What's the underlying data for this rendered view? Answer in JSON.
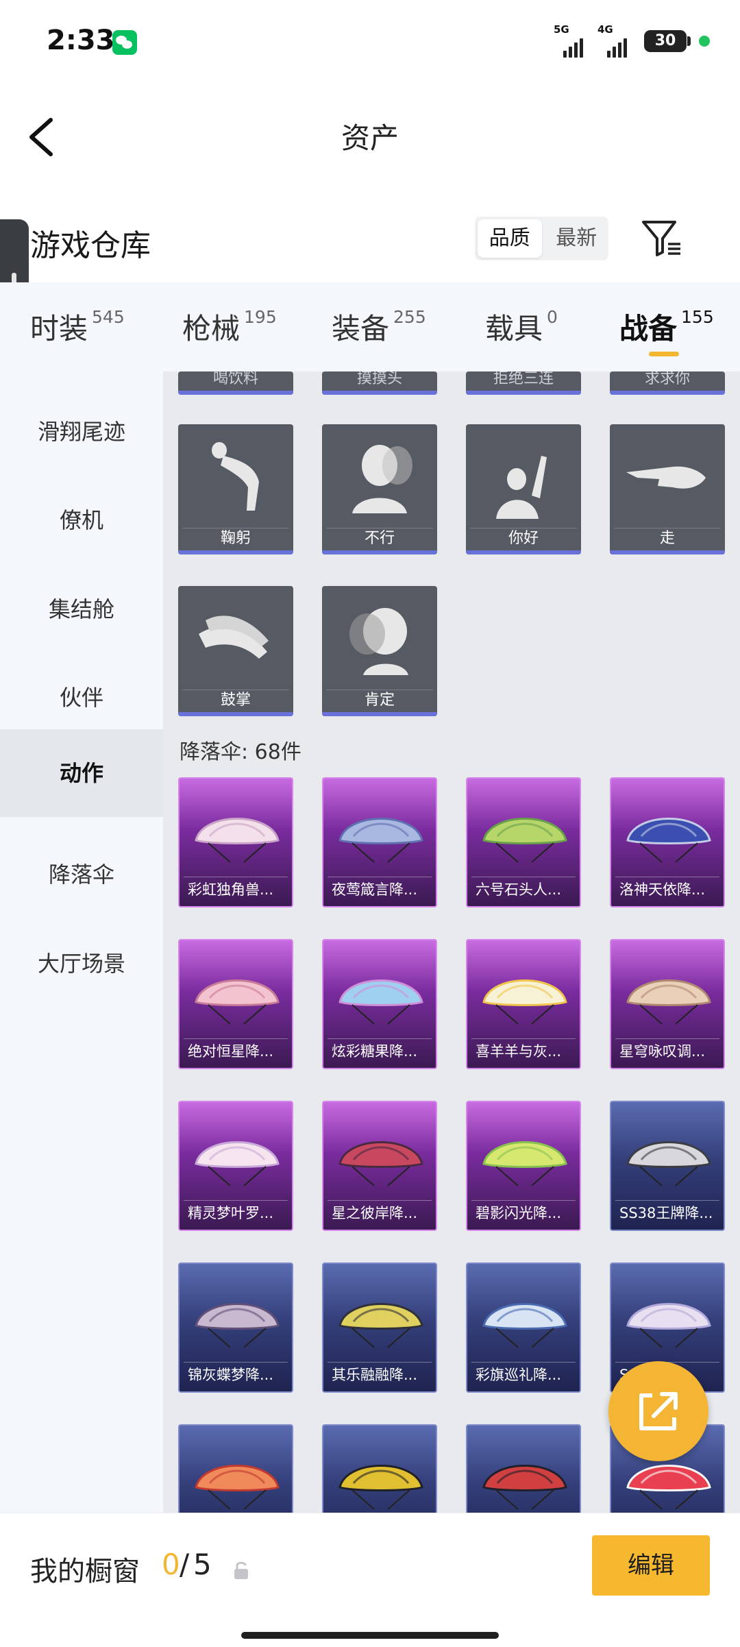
{
  "status_bar": {
    "time": "2:33",
    "sig1_label": "5G",
    "sig2_label": "4G",
    "battery": "30"
  },
  "header": {
    "title": "资产"
  },
  "section": {
    "title": "游戏仓库",
    "sort_options": [
      "品质",
      "最新"
    ]
  },
  "tabs": [
    {
      "label": "时装",
      "count": "545"
    },
    {
      "label": "枪械",
      "count": "195"
    },
    {
      "label": "装备",
      "count": "255"
    },
    {
      "label": "载具",
      "count": "0"
    },
    {
      "label": "战备",
      "count": "155",
      "active": true
    }
  ],
  "sidenav": [
    "滑翔尾迹",
    "僚机",
    "集结舱",
    "伙伴",
    "动作",
    "降落伞",
    "大厅场景"
  ],
  "sidenav_active": "动作",
  "actions_partial": [
    "喝饮料",
    "摸摸头",
    "拒绝三连",
    "求求你"
  ],
  "actions": [
    "鞠躬",
    "不行",
    "你好",
    "走",
    "鼓掌",
    "肯定"
  ],
  "parachute_heading": "降落伞: 68件",
  "parachutes": [
    "彩虹独角兽...",
    "夜莺箴言降...",
    "六号石头人...",
    "洛神天依降...",
    "绝对恒星降...",
    "炫彩糖果降...",
    "喜羊羊与灰...",
    "星穹咏叹调...",
    "精灵梦叶罗...",
    "星之彼岸降...",
    "碧影闪光降...",
    "SS38王牌降...",
    "锦灰蝶梦降...",
    "其乐融融降...",
    "彩旗巡礼降...",
    "S...降..."
  ],
  "colors": {
    "accent": "#f2b631",
    "action_card": "#565a63",
    "rarity_purple": "#a33fc4",
    "rarity_blue": "#3a4590"
  },
  "bottom": {
    "showcase_label": "我的橱窗",
    "showcase_current": "0",
    "showcase_sep": "/",
    "showcase_max": "5",
    "edit_label": "编辑"
  },
  "icons": [
    "back-arrow-icon",
    "filter-icon",
    "share-icon",
    "lock-icon",
    "wechat-icon"
  ]
}
